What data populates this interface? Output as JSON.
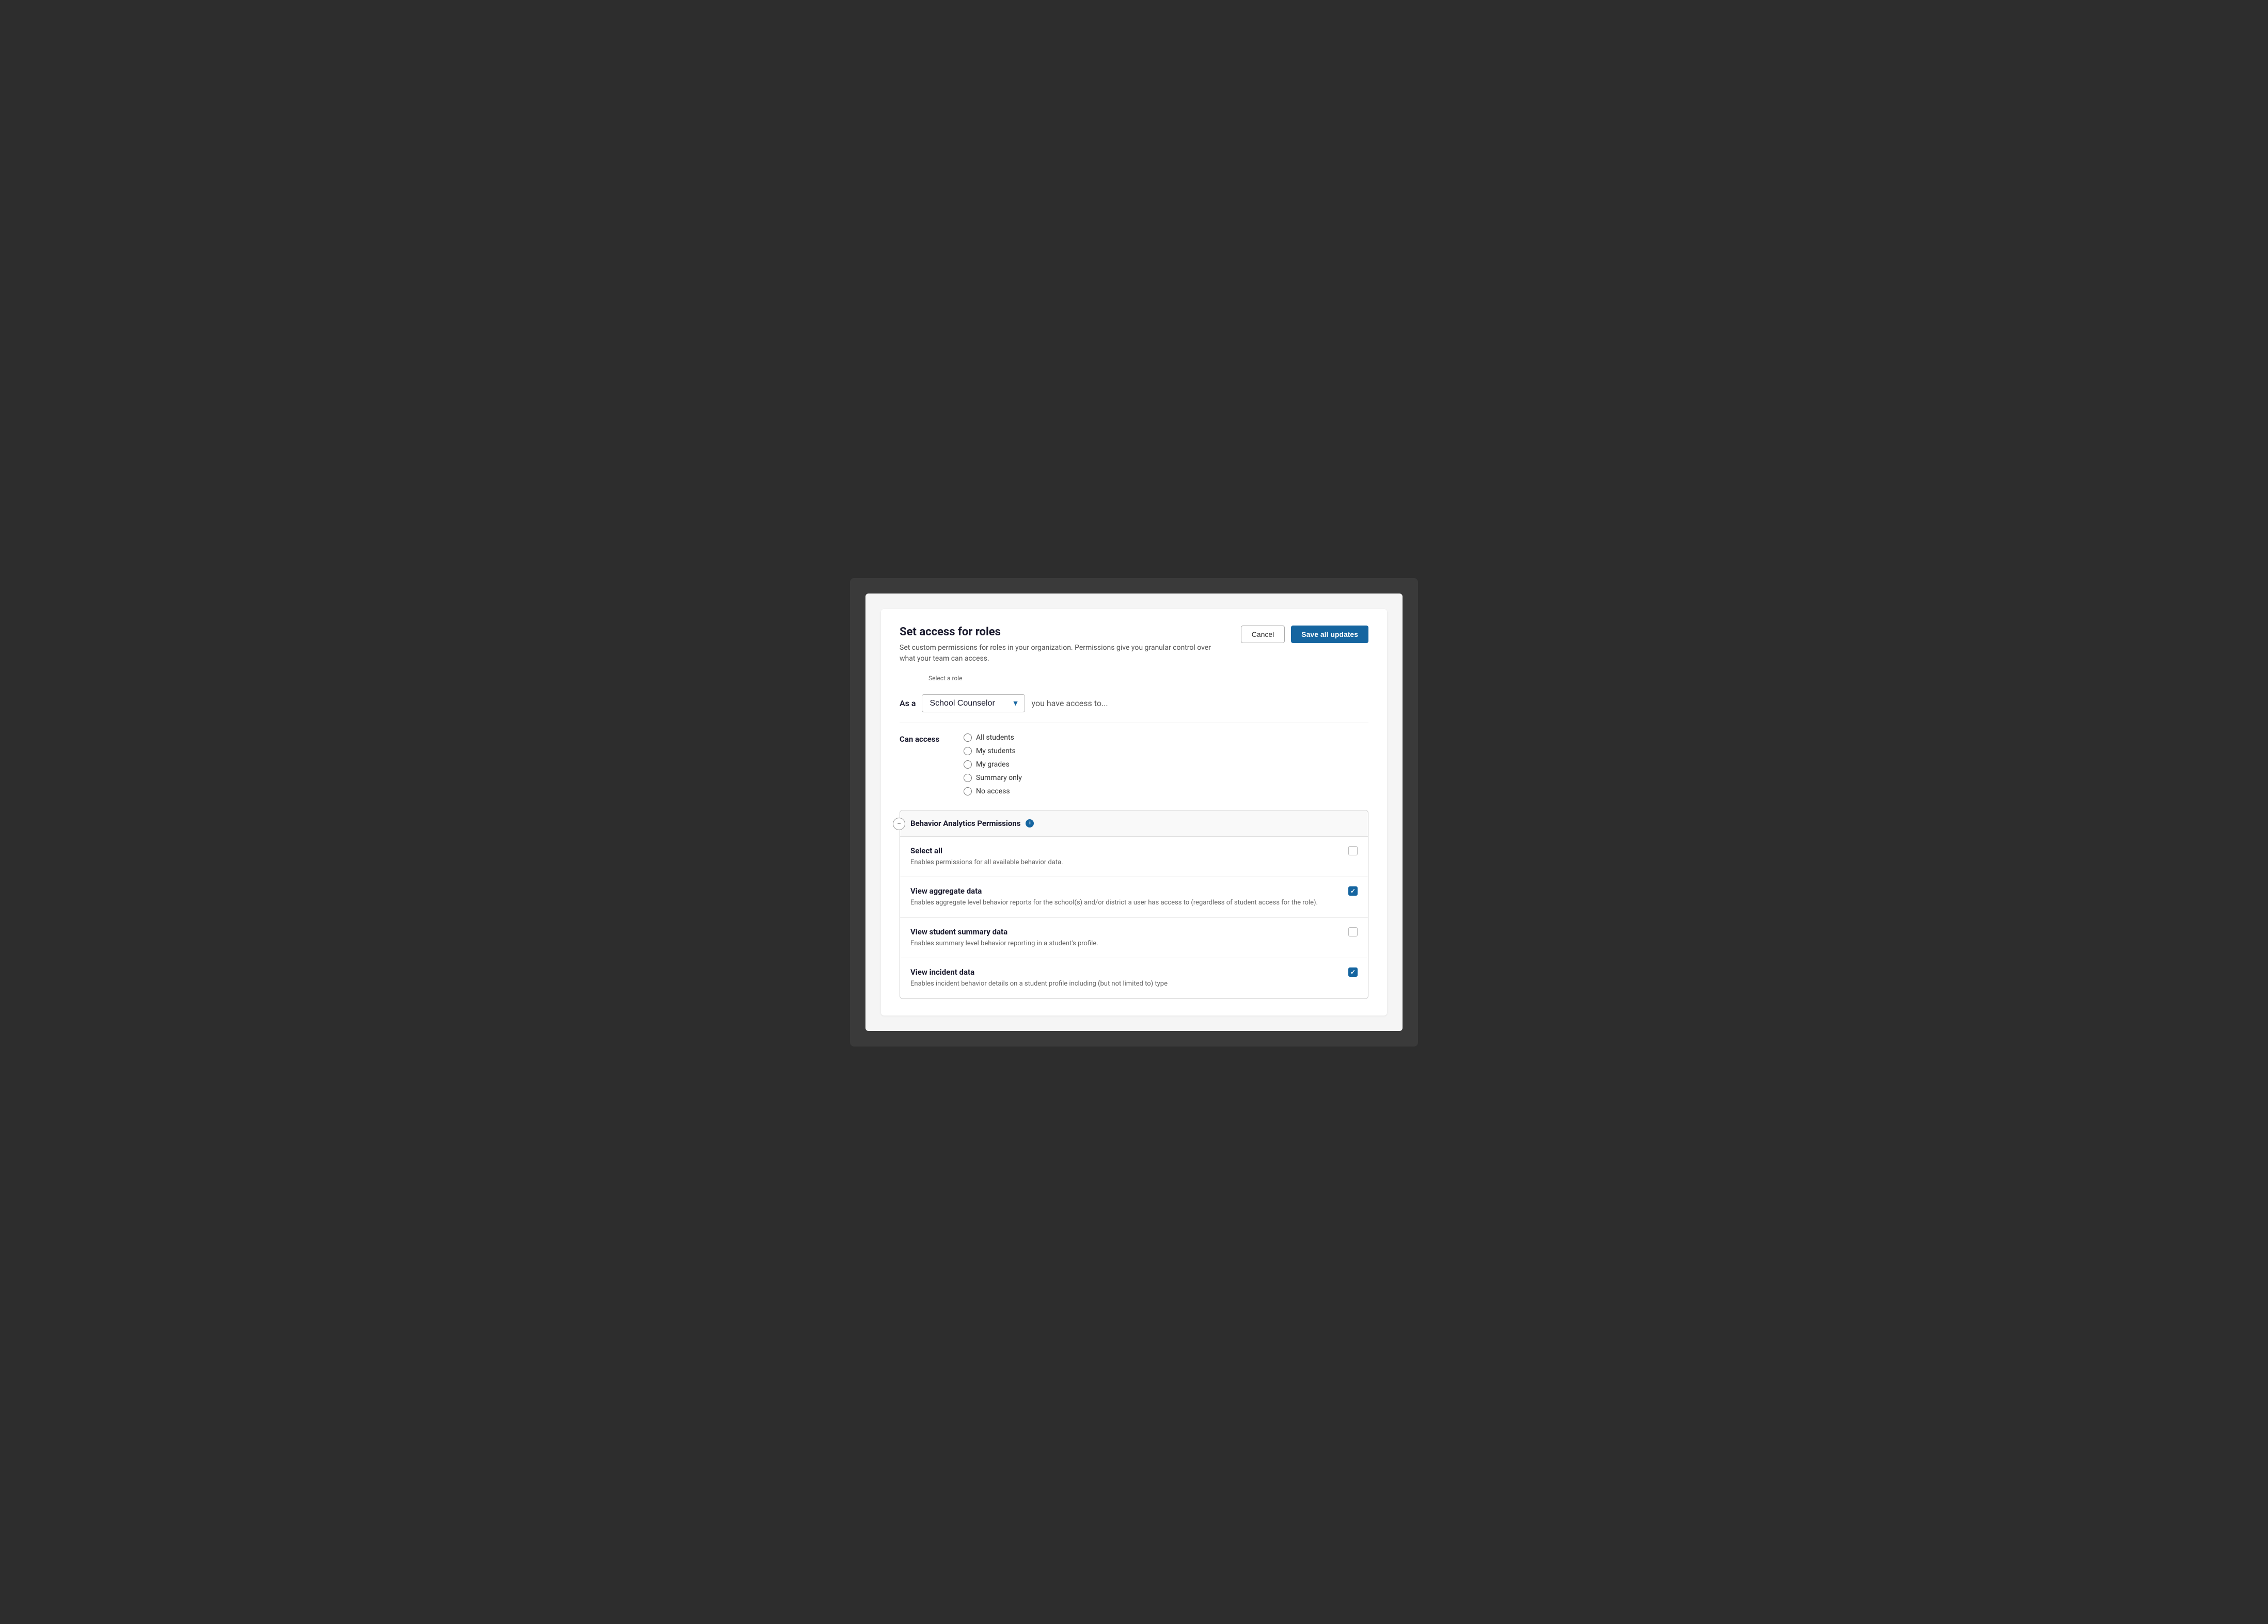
{
  "page": {
    "background": "#2d2d2d",
    "title": "Set access for roles",
    "description": "Set custom permissions for roles in your organization.  Permissions give you granular control over what your team can access.",
    "cancel_label": "Cancel",
    "save_label": "Save all updates",
    "role_selector_label": "Select a role",
    "as_a_text": "As a",
    "you_have_access_text": "you have access to...",
    "selected_role": "School Counselor",
    "can_access_label": "Can access",
    "radio_options": [
      {
        "id": "all-students",
        "label": "All students",
        "checked": false
      },
      {
        "id": "my-students",
        "label": "My students",
        "checked": false
      },
      {
        "id": "my-grades",
        "label": "My grades",
        "checked": false
      },
      {
        "id": "summary-only",
        "label": "Summary only",
        "checked": false
      },
      {
        "id": "no-access",
        "label": "No access",
        "checked": false
      }
    ],
    "permissions_section": {
      "title": "Behavior Analytics Permissions",
      "info_icon_label": "i",
      "permissions": [
        {
          "id": "select-all",
          "name": "Select all",
          "description": "Enables permissions for all available behavior data.",
          "checked": false
        },
        {
          "id": "view-aggregate-data",
          "name": "View aggregate data",
          "description": "Enables aggregate level behavior reports for the school(s) and/or district a user has access to (regardless of student access for the role).",
          "checked": true
        },
        {
          "id": "view-student-summary-data",
          "name": "View student summary data",
          "description": "Enables summary level behavior reporting in a student's profile.",
          "checked": false
        },
        {
          "id": "view-incident-data",
          "name": "View incident data",
          "description": "Enables incident behavior details on a student profile including (but not limited to) type",
          "checked": true
        }
      ]
    }
  }
}
